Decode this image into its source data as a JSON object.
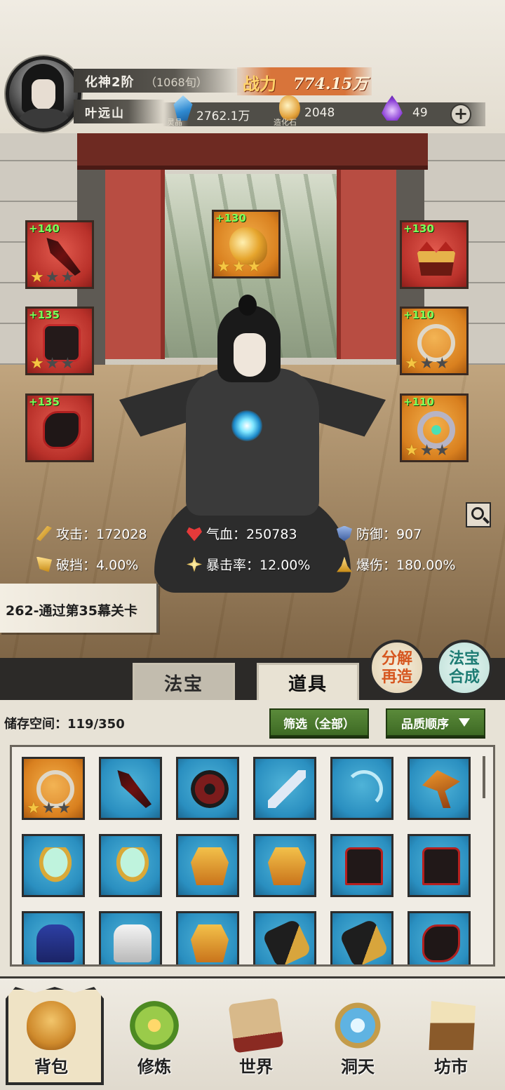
{
  "header": {
    "realm": "化神2阶",
    "realm_detail": "（1068旬）",
    "player_name": "叶远山",
    "power_label": "战力",
    "power_value": "774.15万",
    "currencies": [
      {
        "icon": "spirit-crystal-icon",
        "label": "灵晶",
        "value": "2762.1万"
      },
      {
        "icon": "creation-stone-icon",
        "label": "造化石",
        "value": "2048"
      },
      {
        "icon": "purple-soul-icon",
        "label": "",
        "value": "49"
      }
    ]
  },
  "equipment": {
    "left": [
      {
        "bonus": "+140",
        "item": "dagger-icon",
        "stars": 1
      },
      {
        "bonus": "+135",
        "item": "robe-icon",
        "stars": 1
      },
      {
        "bonus": "+135",
        "item": "boots-icon",
        "stars": 0
      }
    ],
    "center": {
      "bonus": "+130",
      "item": "cloud-treasure-icon",
      "stars": 3
    },
    "right": [
      {
        "bonus": "+130",
        "item": "crown-icon",
        "stars": 0
      },
      {
        "bonus": "+110",
        "item": "pendant-icon",
        "stars": 1
      },
      {
        "bonus": "+110",
        "item": "ring-icon",
        "stars": 1
      }
    ],
    "max_stars": 3,
    "colors": {
      "red": "#b9312a",
      "gold": "#d9801f",
      "bonus": "#7dff5a",
      "star_on": "#f5c542"
    }
  },
  "stats": {
    "attack": "攻击：172028",
    "hp": "气血：250783",
    "defense": "防御：907",
    "pierce": "破挡：4.00%",
    "crit_rate": "暴击率：12.00%",
    "crit_dmg": "爆伤：180.00%"
  },
  "quest": "262-通过第35幕关卡",
  "tabs": {
    "fabao": "法宝",
    "daoju": "道具"
  },
  "round_buttons": {
    "decompose_line1": "分解",
    "decompose_line2": "再造",
    "combine_line1": "法宝",
    "combine_line2": "合成"
  },
  "inventory": {
    "storage": "储存空间：119/350",
    "filter": "筛选（全部）",
    "sort": "品质顺序",
    "items": [
      {
        "icon": "necklace-icon",
        "quality": "gold",
        "stars": 1
      },
      {
        "icon": "dagger-icon",
        "quality": "blue",
        "stars": 0
      },
      {
        "icon": "wheel-icon",
        "quality": "blue",
        "stars": 0
      },
      {
        "icon": "sword-icon",
        "quality": "blue",
        "stars": 0
      },
      {
        "icon": "bow-icon",
        "quality": "blue",
        "stars": 0
      },
      {
        "icon": "axe-icon",
        "quality": "blue",
        "stars": 0
      },
      {
        "icon": "mirror-icon",
        "quality": "blue",
        "stars": 0
      },
      {
        "icon": "mirror-icon",
        "quality": "blue",
        "stars": 0
      },
      {
        "icon": "golden-armor-icon",
        "quality": "blue",
        "stars": 0
      },
      {
        "icon": "golden-armor-icon",
        "quality": "blue",
        "stars": 0
      },
      {
        "icon": "dark-robe-icon",
        "quality": "blue",
        "stars": 0
      },
      {
        "icon": "dark-robe-icon",
        "quality": "blue",
        "stars": 0
      },
      {
        "icon": "blue-robe-icon",
        "quality": "blue",
        "stars": 0
      },
      {
        "icon": "white-robe-icon",
        "quality": "blue",
        "stars": 0
      },
      {
        "icon": "golden-armor-icon",
        "quality": "blue",
        "stars": 0
      },
      {
        "icon": "bracer-icon",
        "quality": "blue",
        "stars": 0
      },
      {
        "icon": "bracer-icon",
        "quality": "blue",
        "stars": 0
      },
      {
        "icon": "boots-icon",
        "quality": "blue",
        "stars": 0
      }
    ]
  },
  "nav": [
    {
      "label": "背包",
      "icon": "bag-icon"
    },
    {
      "label": "修炼",
      "icon": "lotus-icon"
    },
    {
      "label": "世界",
      "icon": "scroll-map-icon"
    },
    {
      "label": "洞天",
      "icon": "portal-icon"
    },
    {
      "label": "坊市",
      "icon": "market-stall-icon"
    }
  ]
}
